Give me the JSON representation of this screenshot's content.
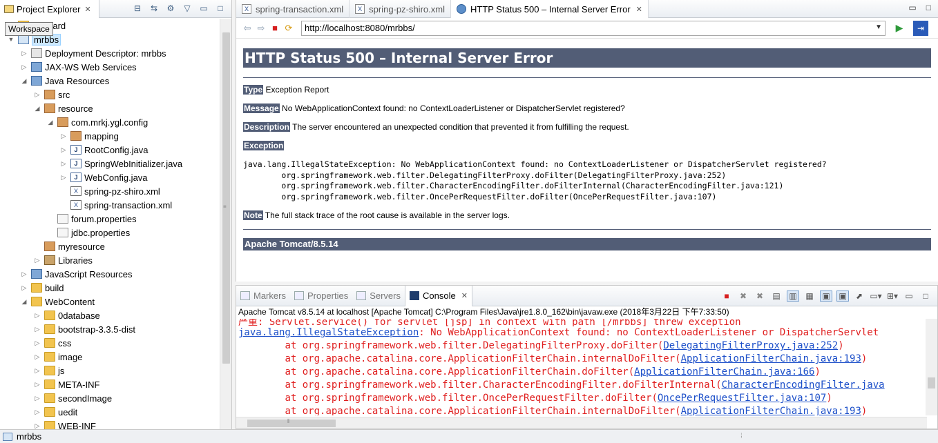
{
  "project_explorer": {
    "tab_title": "Project Explorer",
    "tooltip": "Workspace",
    "tree": [
      {
        "label": "geBoard",
        "level": 0,
        "arrow": "",
        "icon": "folder"
      },
      {
        "label": "mrbbs",
        "level": 0,
        "arrow": "▼",
        "icon": "project",
        "selected": true
      },
      {
        "label": "Deployment Descriptor: mrbbs",
        "level": 1,
        "arrow": "▷",
        "icon": "dd"
      },
      {
        "label": "JAX-WS Web Services",
        "level": 1,
        "arrow": "▷",
        "icon": "web"
      },
      {
        "label": "Java Resources",
        "level": 1,
        "arrow": "◢",
        "icon": "web"
      },
      {
        "label": "src",
        "level": 2,
        "arrow": "▷",
        "icon": "pkg"
      },
      {
        "label": "resource",
        "level": 2,
        "arrow": "◢",
        "icon": "pkg"
      },
      {
        "label": "com.mrkj.ygl.config",
        "level": 3,
        "arrow": "◢",
        "icon": "pkg"
      },
      {
        "label": "mapping",
        "level": 4,
        "arrow": "▷",
        "icon": "pkg"
      },
      {
        "label": "RootConfig.java",
        "level": 4,
        "arrow": "▷",
        "icon": "java"
      },
      {
        "label": "SpringWebInitializer.java",
        "level": 4,
        "arrow": "▷",
        "icon": "java"
      },
      {
        "label": "WebConfig.java",
        "level": 4,
        "arrow": "▷",
        "icon": "java"
      },
      {
        "label": "spring-pz-shiro.xml",
        "level": 4,
        "arrow": "",
        "icon": "xml"
      },
      {
        "label": "spring-transaction.xml",
        "level": 4,
        "arrow": "",
        "icon": "xml"
      },
      {
        "label": "forum.properties",
        "level": 3,
        "arrow": "",
        "icon": "prop"
      },
      {
        "label": "jdbc.properties",
        "level": 3,
        "arrow": "",
        "icon": "prop"
      },
      {
        "label": "myresource",
        "level": 2,
        "arrow": "",
        "icon": "pkg"
      },
      {
        "label": "Libraries",
        "level": 2,
        "arrow": "▷",
        "icon": "lib"
      },
      {
        "label": "JavaScript Resources",
        "level": 1,
        "arrow": "▷",
        "icon": "web"
      },
      {
        "label": "build",
        "level": 1,
        "arrow": "▷",
        "icon": "folder"
      },
      {
        "label": "WebContent",
        "level": 1,
        "arrow": "◢",
        "icon": "folder"
      },
      {
        "label": "0database",
        "level": 2,
        "arrow": "▷",
        "icon": "folder"
      },
      {
        "label": "bootstrap-3.3.5-dist",
        "level": 2,
        "arrow": "▷",
        "icon": "folder"
      },
      {
        "label": "css",
        "level": 2,
        "arrow": "▷",
        "icon": "folder"
      },
      {
        "label": "image",
        "level": 2,
        "arrow": "▷",
        "icon": "folder"
      },
      {
        "label": "js",
        "level": 2,
        "arrow": "▷",
        "icon": "folder"
      },
      {
        "label": "META-INF",
        "level": 2,
        "arrow": "▷",
        "icon": "folder"
      },
      {
        "label": "secondImage",
        "level": 2,
        "arrow": "▷",
        "icon": "folder"
      },
      {
        "label": "uedit",
        "level": 2,
        "arrow": "▷",
        "icon": "folder"
      },
      {
        "label": "WEB-INF",
        "level": 2,
        "arrow": "▷",
        "icon": "folder"
      }
    ]
  },
  "editor": {
    "tabs": [
      {
        "label": "spring-transaction.xml",
        "active": false
      },
      {
        "label": "spring-pz-shiro.xml",
        "active": false
      },
      {
        "label": "HTTP Status 500 – Internal Server Error",
        "active": true
      }
    ],
    "url": "http://localhost:8080/mrbbs/"
  },
  "page": {
    "title": "HTTP Status 500 – Internal Server Error",
    "type_label": "Type",
    "type_value": " Exception Report",
    "message_label": "Message",
    "message_value": " No WebApplicationContext found: no ContextLoaderListener or DispatcherServlet registered?",
    "description_label": "Description",
    "description_value": " The server encountered an unexpected condition that prevented it from fulfilling the request.",
    "exception_label": "Exception",
    "stack": [
      "java.lang.IllegalStateException: No WebApplicationContext found: no ContextLoaderListener or DispatcherServlet registered?",
      "\torg.springframework.web.filter.DelegatingFilterProxy.doFilter(DelegatingFilterProxy.java:252)",
      "\torg.springframework.web.filter.CharacterEncodingFilter.doFilterInternal(CharacterEncodingFilter.java:121)",
      "\torg.springframework.web.filter.OncePerRequestFilter.doFilter(OncePerRequestFilter.java:107)"
    ],
    "note_label": "Note",
    "note_value": " The full stack trace of the root cause is available in the server logs.",
    "footer": "Apache Tomcat/8.5.14"
  },
  "console": {
    "tabs": [
      {
        "label": "Markers",
        "active": false
      },
      {
        "label": "Properties",
        "active": false
      },
      {
        "label": "Servers",
        "active": false
      },
      {
        "label": "Console",
        "active": true
      }
    ],
    "header": "Apache Tomcat v8.5.14 at localhost [Apache Tomcat] C:\\Program Files\\Java\\jre1.8.0_162\\bin\\javaw.exe (2018年3月22日 下午7:33:50)",
    "cut_line": "严重: Servlet.service() for servlet [jsp] in context with path [/mrbbs] threw exception",
    "lines": [
      {
        "pre": "",
        "link": "java.lang.IllegalStateException",
        "post": ": No WebApplicationContext found: no ContextLoaderListener or DispatcherServlet"
      },
      {
        "pre": "\tat org.springframework.web.filter.DelegatingFilterProxy.doFilter(",
        "link": "DelegatingFilterProxy.java:252",
        "post": ")"
      },
      {
        "pre": "\tat org.apache.catalina.core.ApplicationFilterChain.internalDoFilter(",
        "link": "ApplicationFilterChain.java:193",
        "post": ")"
      },
      {
        "pre": "\tat org.apache.catalina.core.ApplicationFilterChain.doFilter(",
        "link": "ApplicationFilterChain.java:166",
        "post": ")"
      },
      {
        "pre": "\tat org.springframework.web.filter.CharacterEncodingFilter.doFilterInternal(",
        "link": "CharacterEncodingFilter.java",
        "post": ""
      },
      {
        "pre": "\tat org.springframework.web.filter.OncePerRequestFilter.doFilter(",
        "link": "OncePerRequestFilter.java:107",
        "post": ")"
      },
      {
        "pre": "\tat org.apache.catalina.core.ApplicationFilterChain.internalDoFilter(",
        "link": "ApplicationFilterChain.java:193",
        "post": ")"
      }
    ]
  },
  "status_bar": {
    "text": "mrbbs"
  }
}
